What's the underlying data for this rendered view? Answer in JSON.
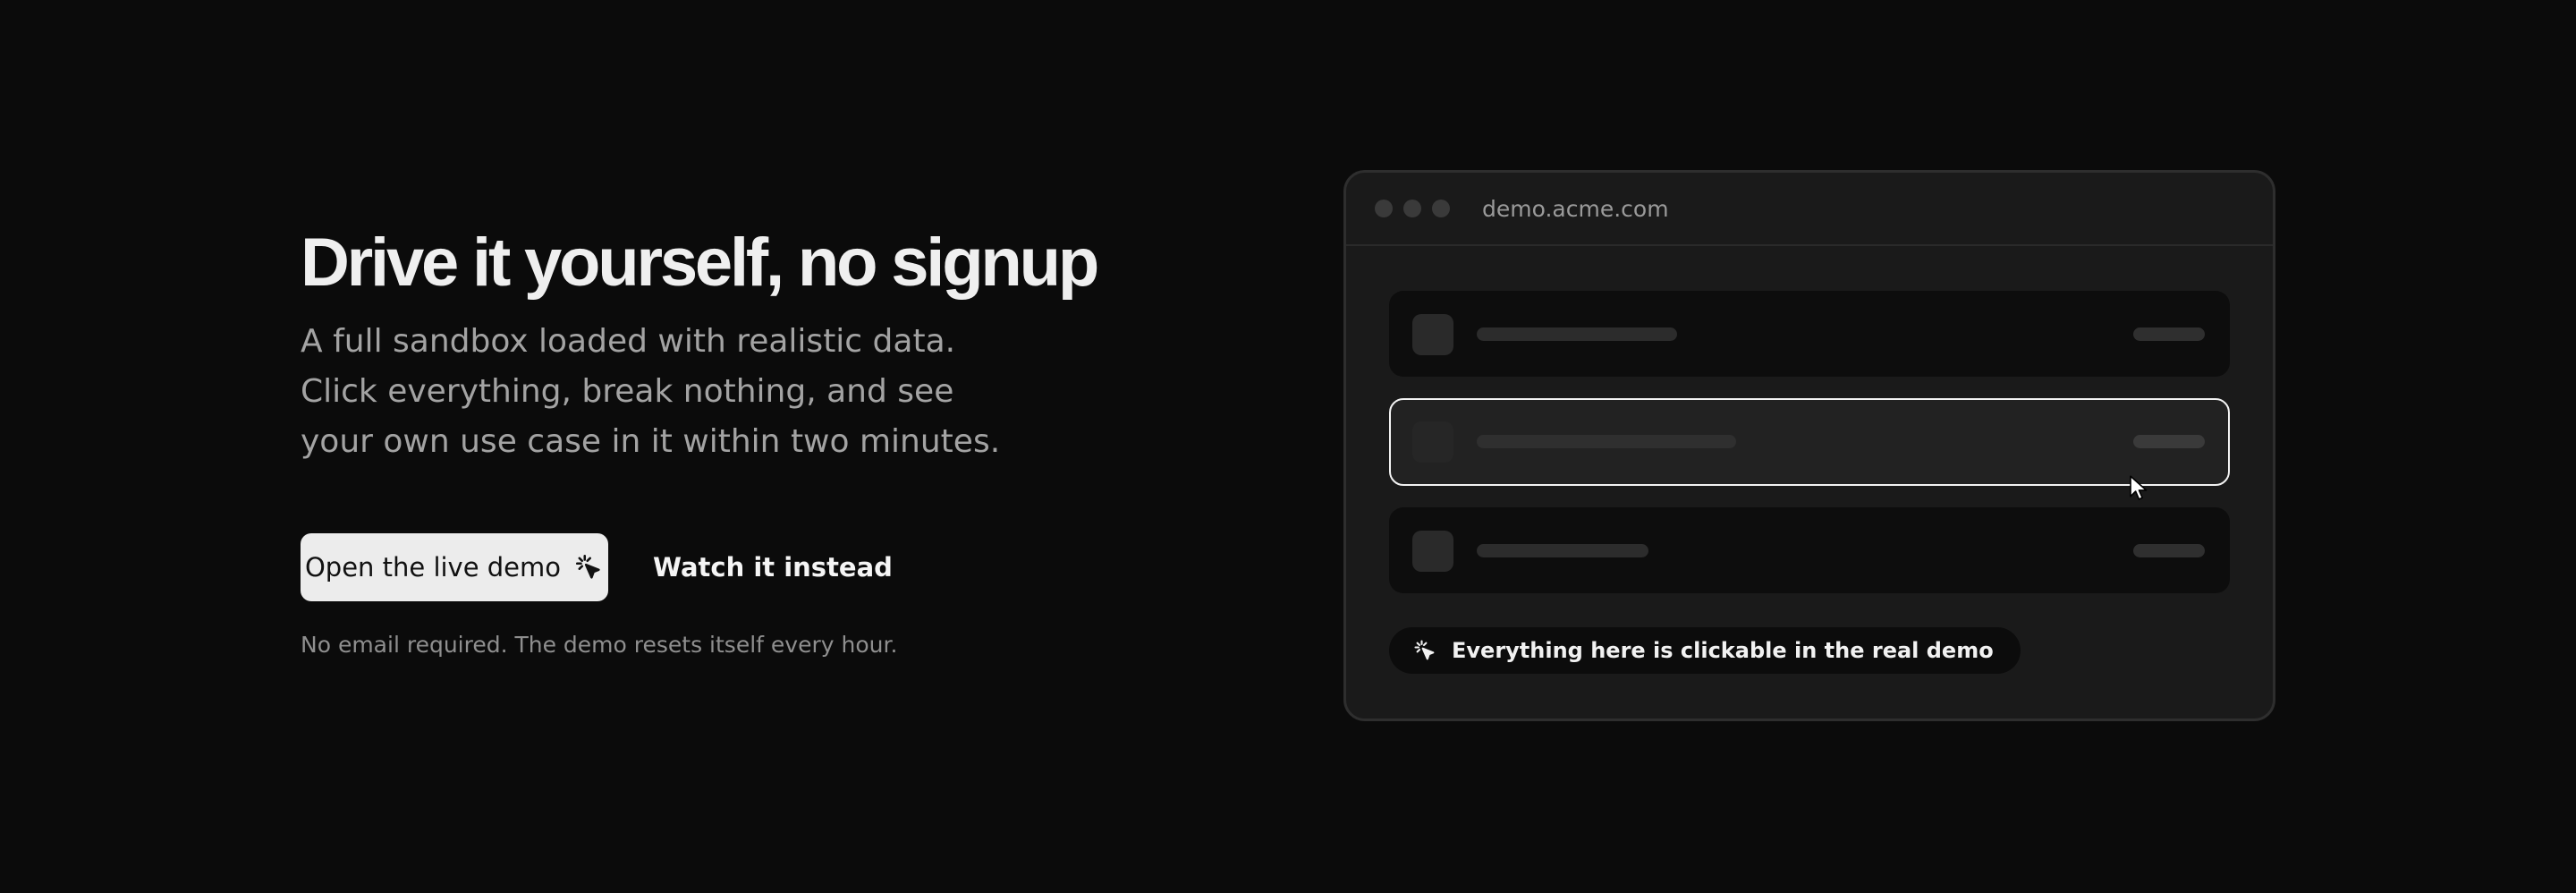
{
  "hero": {
    "headline": "Drive it yourself, no signup",
    "subhead_lines": [
      "A full sandbox loaded with realistic data.",
      "Click everything, break nothing, and see",
      "your own use case in it within two minutes."
    ],
    "primary_cta": {
      "label": "Open the live demo",
      "icon": "sparkle-cursor-icon"
    },
    "secondary_cta": {
      "label": "Watch it instead"
    },
    "footnote": "No email required. The demo resets itself every hour."
  },
  "preview": {
    "url": "demo.acme.com",
    "window_controls": [
      "close-dot",
      "minimize-dot",
      "maximize-dot"
    ],
    "rows": [
      {
        "state": "default"
      },
      {
        "state": "selected"
      },
      {
        "state": "default"
      }
    ],
    "badge": {
      "icon": "sparkle-cursor-icon",
      "label": "Everything here is clickable in the real demo"
    }
  },
  "colors": {
    "background": "#0b0b0b",
    "headline": "#efefef",
    "body_text": "#a3a3a3",
    "primary_button_bg": "#ececec",
    "panel": "#1a1a1a",
    "selected_row_border": "#f3f3f3"
  }
}
